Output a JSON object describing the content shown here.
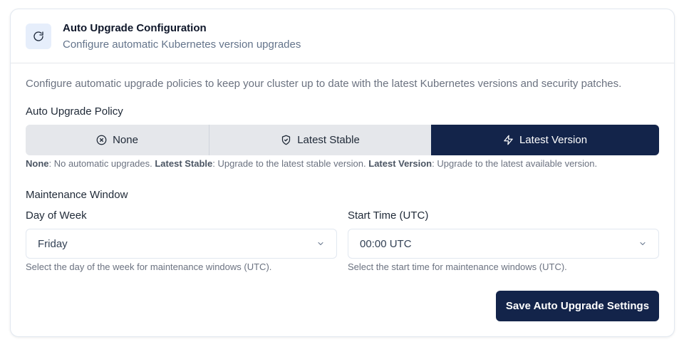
{
  "header": {
    "title": "Auto Upgrade Configuration",
    "subtitle": "Configure automatic Kubernetes version upgrades",
    "icon": "refresh-icon"
  },
  "intro": "Configure automatic upgrade policies to keep your cluster up to date with the latest Kubernetes versions and security patches.",
  "policy": {
    "label": "Auto Upgrade Policy",
    "options": [
      {
        "label": "None",
        "icon": "x-circle-icon"
      },
      {
        "label": "Latest Stable",
        "icon": "shield-icon"
      },
      {
        "label": "Latest Version",
        "icon": "zap-icon"
      }
    ],
    "selected": "Latest Version",
    "help": {
      "none_term": "None",
      "none_desc": ": No automatic upgrades. ",
      "stable_term": "Latest Stable",
      "stable_desc": ": Upgrade to the latest stable version. ",
      "latest_term": "Latest Version",
      "latest_desc": ": Upgrade to the latest available version."
    }
  },
  "maintenance": {
    "label": "Maintenance Window",
    "day": {
      "label": "Day of Week",
      "value": "Friday",
      "help": "Select the day of the week for maintenance windows (UTC)."
    },
    "time": {
      "label": "Start Time (UTC)",
      "value": "00:00 UTC",
      "help": "Select the start time for maintenance windows (UTC)."
    }
  },
  "save_label": "Save Auto Upgrade Settings",
  "colors": {
    "accent": "#13244a",
    "icon_bg": "#e6eefb",
    "segment_bg": "#e5e7eb"
  }
}
